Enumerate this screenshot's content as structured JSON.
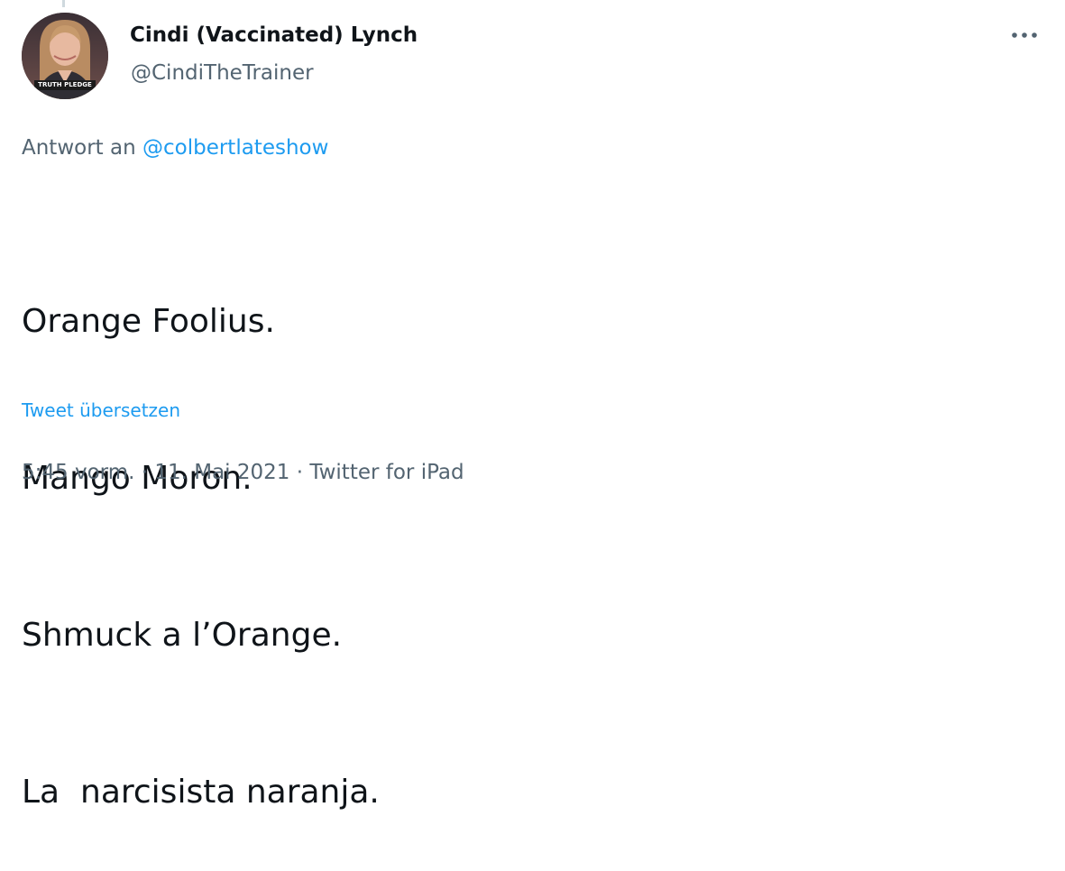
{
  "tweet": {
    "author": {
      "display_name": "Cindi (Vaccinated) Lynch",
      "handle": "@CindiTheTrainer",
      "avatar_badge_text": "TRUTH PLEDGE"
    },
    "reply_to": {
      "prefix": "Antwort an",
      "handle": "@colbertlateshow"
    },
    "text_lines": [
      "Orange Foolius.",
      "Mango Moron.",
      "Shmuck a l’Orange.",
      "La  narcisista naranja."
    ],
    "translate_label": "Tweet übersetzen",
    "meta": {
      "time": "5:45 vorm.",
      "separator": " · ",
      "date": "11. Mai 2021",
      "source": "Twitter for iPad"
    },
    "icons": {
      "more": "more-horizontal-icon"
    },
    "colors": {
      "link": "#1d9bf0",
      "secondary_text": "#536471",
      "primary_text": "#0f1419"
    }
  }
}
